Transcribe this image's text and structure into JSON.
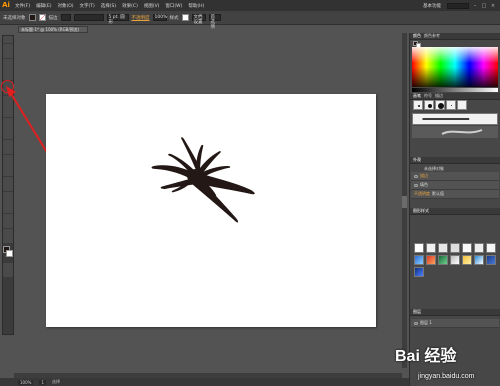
{
  "app": {
    "logo": "Ai",
    "workspace": "基本功能"
  },
  "menu": [
    "文件(F)",
    "编辑(E)",
    "对象(O)",
    "文字(T)",
    "选择(S)",
    "效果(C)",
    "视图(V)",
    "窗口(W)",
    "帮助(H)"
  ],
  "control_bar": {
    "selection": "未选择对象",
    "stroke_label": "描边",
    "stroke_size": "5 pt. 圆形",
    "opacity_label": "不透明度",
    "opacity_value": "100%",
    "style_label": "样式",
    "doc_setup": "文档设置",
    "prefs": "首选项"
  },
  "document_tab": "未标题-1* @ 100% (RGB/预览)",
  "panels": {
    "color_tabs": [
      "颜色",
      "颜色参考"
    ],
    "brush_tabs": [
      "画笔",
      "符号",
      "描边"
    ],
    "brush_basic": "基本",
    "stroke_weight": "6.00",
    "appearance_title": "外观",
    "appearance_object": "未选择对象",
    "appearance_stroke": "描边",
    "appearance_fill": "填色",
    "appearance_opacity": "不透明度",
    "appearance_opacity_value": "默认值",
    "graphic_styles_title": "图形样式",
    "layers_title": "图层",
    "layer_name": "图层 1"
  },
  "status": {
    "zoom": "100%",
    "page": "1",
    "tool": "选择"
  },
  "watermark": {
    "brand": "Bai 经验",
    "url": "jingyan.baidu.com"
  },
  "colors": {
    "accent": "#ff9a00",
    "highlight": "#e02020",
    "canvas": "#ffffff",
    "workspace": "#535353"
  }
}
